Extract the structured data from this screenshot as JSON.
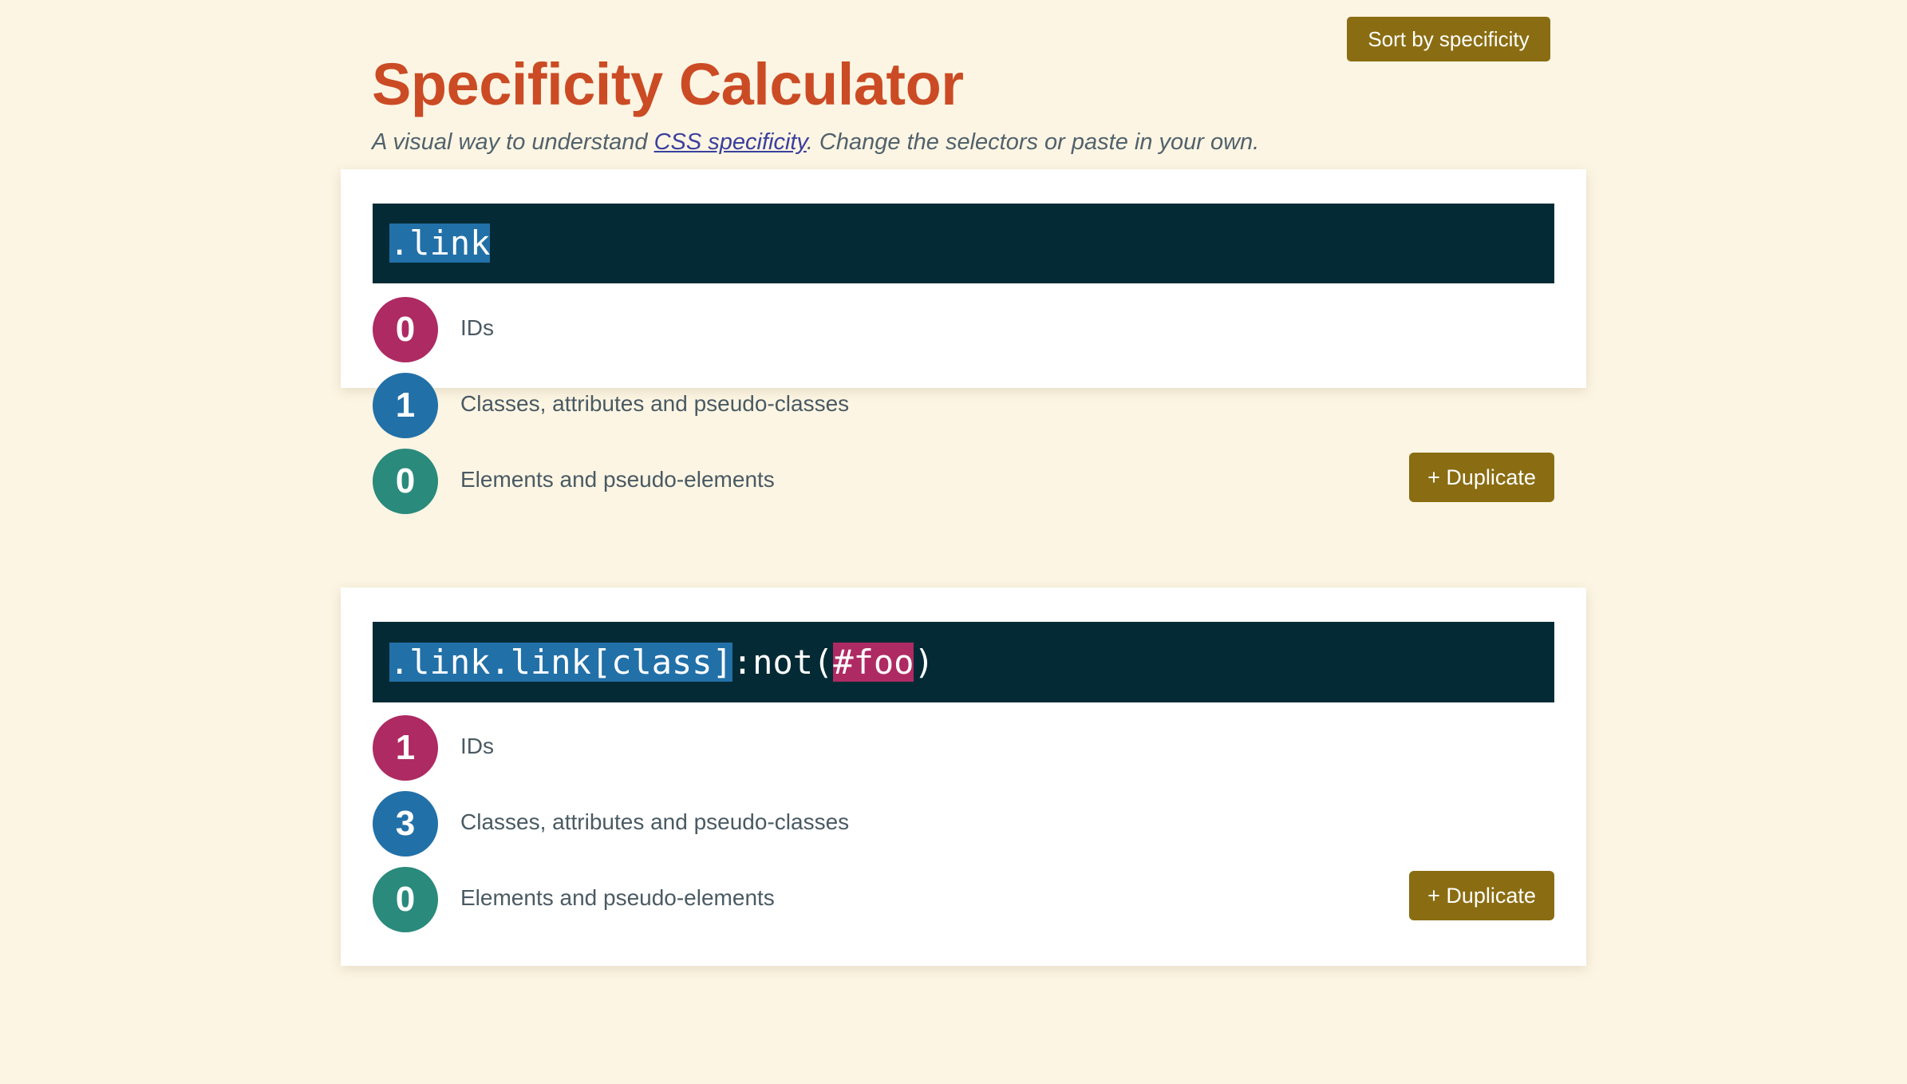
{
  "header": {
    "title": "Specificity Calculator",
    "subtitle_before": "A visual way to understand ",
    "subtitle_link": "CSS specificity",
    "subtitle_after": ". Change the selectors or paste in your own.",
    "sort_button_label": "Sort by specificity"
  },
  "colors": {
    "background": "#fcf5e3",
    "title": "#cb4b25",
    "link": "#3b3f9e",
    "button": "#8a6d12",
    "code_background": "#042b35",
    "highlight_class": "#2270a8",
    "highlight_id": "#ae2a63",
    "badge_ids": "#ae2a63",
    "badge_classes": "#2270a8",
    "badge_elements": "#2a8a7c",
    "label_text": "#4a5a63",
    "card_background": "#ffffff"
  },
  "labels": {
    "ids": "IDs",
    "classes": "Classes, attributes and pseudo-classes",
    "elements": "Elements and pseudo-elements",
    "duplicate": "+ Duplicate"
  },
  "cards": [
    {
      "selector_text": ".link",
      "tokens": [
        {
          "text": ".link",
          "kind": "class"
        }
      ],
      "ids": "0",
      "classes": "1",
      "elements": "0",
      "duplicate_label": "+ Duplicate"
    },
    {
      "selector_text": ".link.link[class]:not(#foo)",
      "tokens": [
        {
          "text": ".link.link[class]",
          "kind": "class"
        },
        {
          "text": ":not(",
          "kind": "plain"
        },
        {
          "text": "#foo",
          "kind": "id"
        },
        {
          "text": ")",
          "kind": "plain"
        }
      ],
      "ids": "1",
      "classes": "3",
      "elements": "0",
      "duplicate_label": "+ Duplicate"
    }
  ]
}
